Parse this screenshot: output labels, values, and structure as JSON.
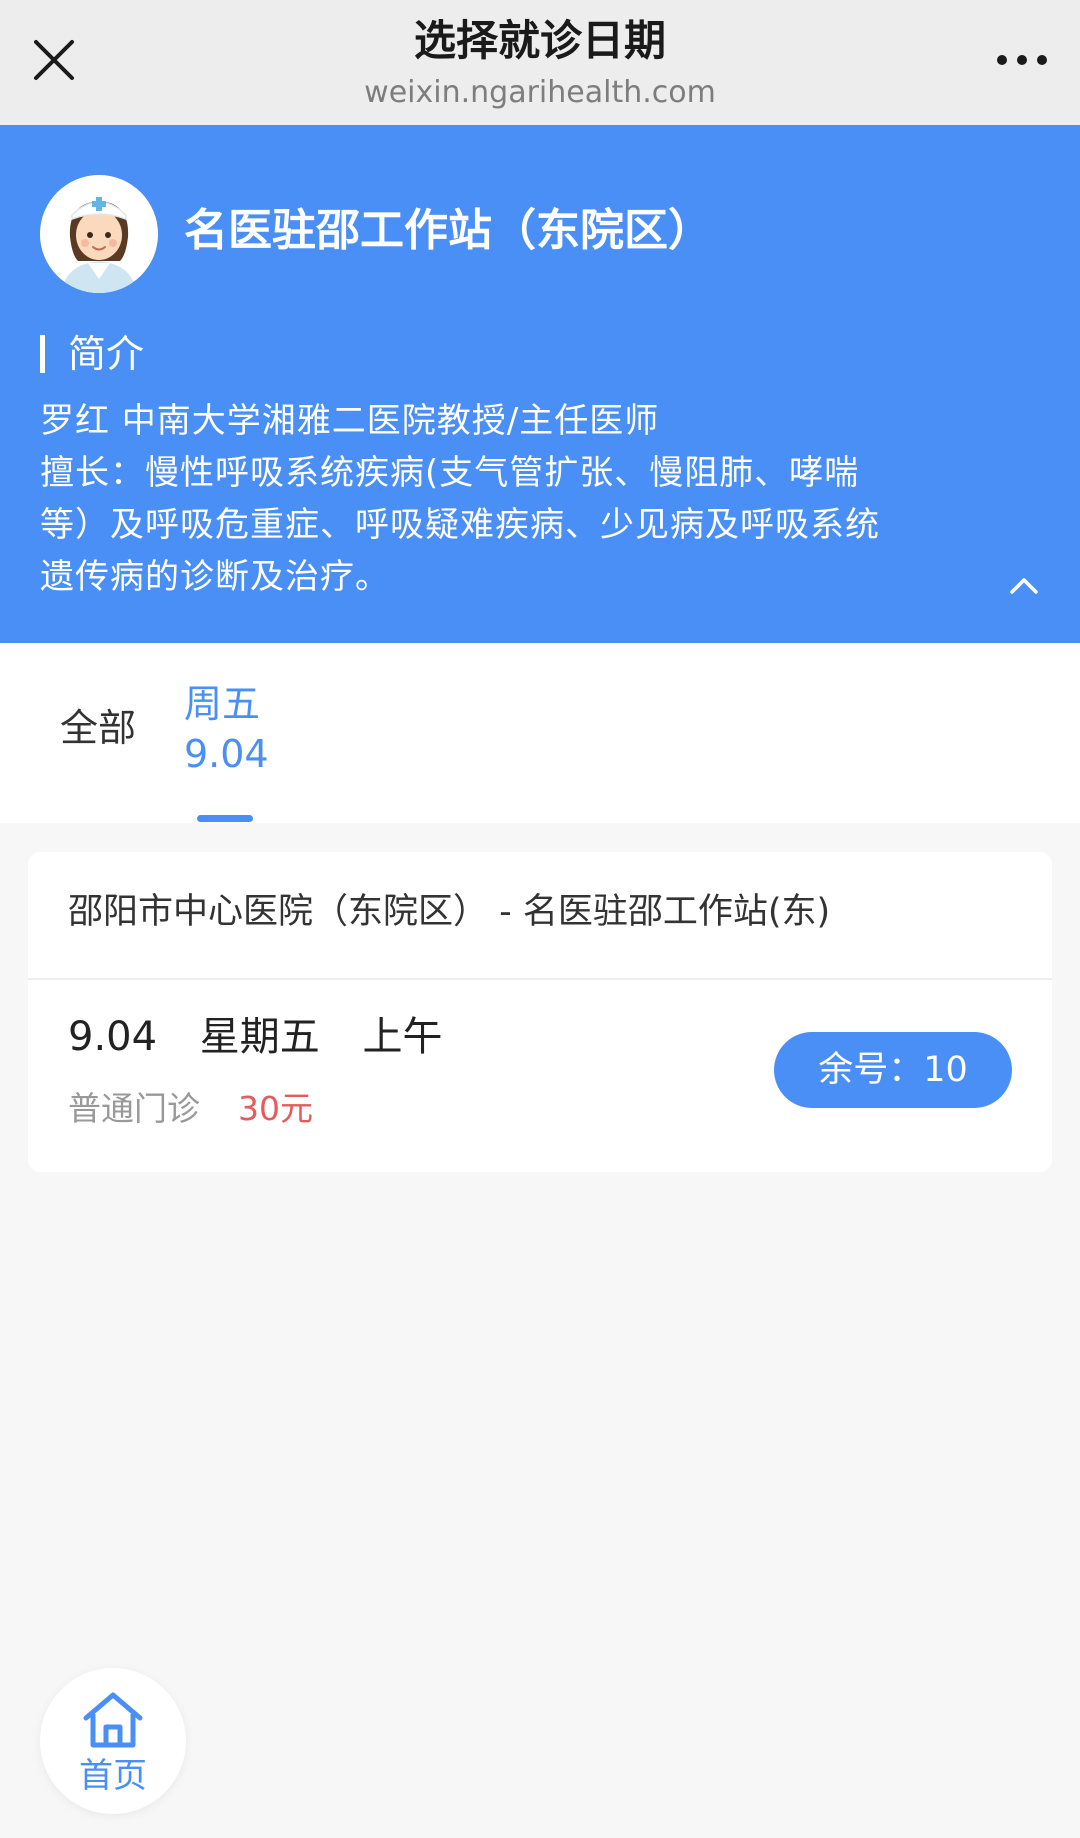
{
  "navbar": {
    "title": "选择就诊日期",
    "url": "weixin.ngarihealth.com",
    "close_icon": "close-icon",
    "more_icon": "more-icon"
  },
  "header": {
    "station_name": "名医驻邵工作站（东院区）",
    "intro_title": "简介",
    "intro_lines": [
      "罗红  中南大学湘雅二医院教授/主任医师",
      "擅长：慢性呼吸系统疾病(支气管扩张、慢阻肺、哮喘",
      "等）及呼吸危重症、呼吸疑难疾病、少见病及呼吸系统",
      "遗传病的诊断及治疗。"
    ],
    "collapse_icon": "chevron-up-icon",
    "background_color": "#4a8ff5"
  },
  "tabs": {
    "all_label": "全部",
    "friday_weekday": "周五",
    "friday_date": "9.04",
    "active_color": "#4a8ff5"
  },
  "schedule": {
    "hospital": "邵阳市中心医院（东院区） - 名医驻邵工作站(东)",
    "date": "9.04",
    "weekday": "星期五",
    "period": "上午",
    "clinic_type": "普通门诊",
    "price": "30元",
    "remaining_label": "余号：10",
    "price_color": "#e55a5a"
  },
  "home": {
    "label": "首页",
    "icon": "home-icon"
  }
}
